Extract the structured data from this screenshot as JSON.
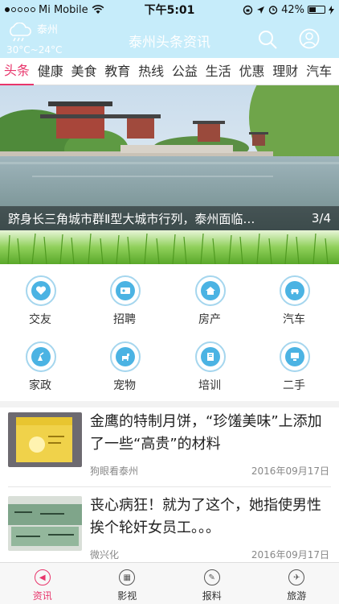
{
  "status": {
    "carrier": "Mi Mobile",
    "time": "下午5:01",
    "battery": "42%",
    "battery_level": 0.42
  },
  "header": {
    "city": "泰州",
    "temperature": "30°C~24°C",
    "title": "泰州头条资讯"
  },
  "tabs": [
    "头条",
    "健康",
    "美食",
    "教育",
    "热线",
    "公益",
    "生活",
    "优惠",
    "理财",
    "汽车"
  ],
  "banner": {
    "caption": "跻身长三角城市群Ⅱ型大城市行列，泰州面临…",
    "index": "3/4"
  },
  "categories": [
    {
      "label": "交友",
      "icon": "heart-icon"
    },
    {
      "label": "招聘",
      "icon": "recruit-icon"
    },
    {
      "label": "房产",
      "icon": "house-icon"
    },
    {
      "label": "汽车",
      "icon": "car-icon"
    },
    {
      "label": "家政",
      "icon": "cleaning-icon"
    },
    {
      "label": "宠物",
      "icon": "pet-icon"
    },
    {
      "label": "培训",
      "icon": "book-icon"
    },
    {
      "label": "二手",
      "icon": "computer-icon"
    }
  ],
  "news": [
    {
      "title": "金鹰的特制月饼，“珍馐美味”上添加了一些“高贵”的材料",
      "source": "狗眼看泰州",
      "date": "2016年09月17日"
    },
    {
      "title": "丧心病狂！就为了这个，她指使男性挨个轮奸女员工。。。",
      "source": "微兴化",
      "date": "2016年09月17日"
    }
  ],
  "bottom_nav": [
    {
      "label": "资讯",
      "icon": "news-icon",
      "active": true
    },
    {
      "label": "影视",
      "icon": "film-icon",
      "active": false
    },
    {
      "label": "报料",
      "icon": "report-icon",
      "active": false
    },
    {
      "label": "旅游",
      "icon": "plane-icon",
      "active": false
    }
  ],
  "colors": {
    "header_bg": "#c6ecfa",
    "accent": "#e8356b",
    "icon_blue": "#4bb3e3"
  }
}
